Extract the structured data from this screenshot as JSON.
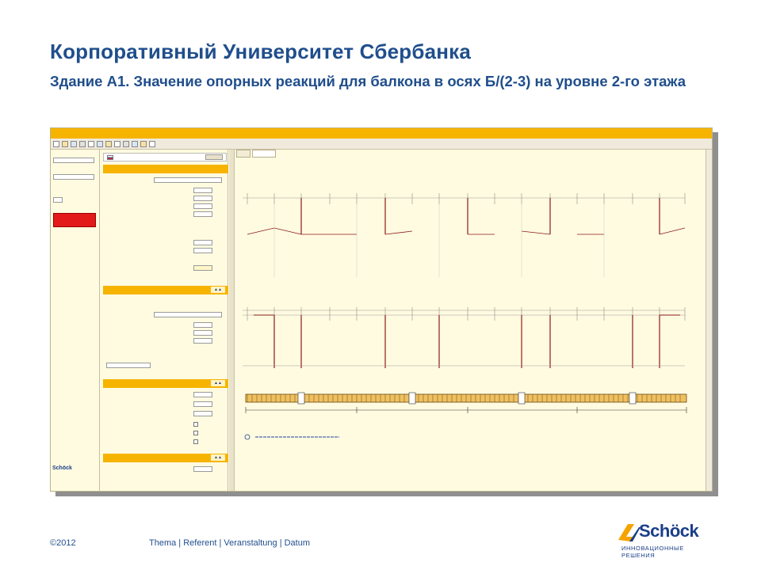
{
  "slide": {
    "title": "Корпоративный Университет Сбербанка",
    "subtitle": "Здание А1. Значение опорных реакций для балкона в осях Б/(2-3) на уровне 2-го этажа"
  },
  "footer": {
    "copyright": "©2012",
    "meta": "Thema | Referent | Veranstaltung | Datum"
  },
  "logo": {
    "wordmark": "Schöck",
    "tagline": "ИННОВАЦИОННЫЕ РЕШЕНИЯ"
  },
  "colors": {
    "title": "#1f4e8c",
    "app_accent": "#f6b400",
    "panel_bg": "#fffbe0",
    "alert_red": "#e21a1a",
    "reaction_line": "#8b1a1a"
  }
}
